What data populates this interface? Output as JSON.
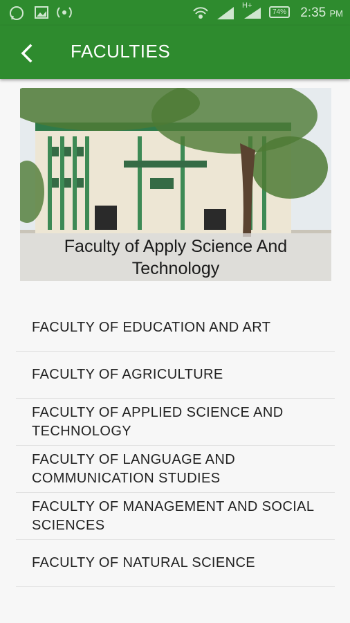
{
  "status_bar": {
    "time": "2:35",
    "ampm": "PM",
    "battery": "74%",
    "network": "H+",
    "icons": [
      "whatsapp-icon",
      "gallery-icon",
      "hotspot-icon",
      "wifi-icon",
      "signal-icon",
      "battery-icon"
    ]
  },
  "app_bar": {
    "title": "FACULTIES",
    "back_icon": "back-arrow-icon"
  },
  "hero": {
    "caption": "Faculty of Apply Science And Technology"
  },
  "faculties": [
    "FACULTY OF EDUCATION AND ART",
    "FACULTY OF AGRICULTURE",
    "FACULTY OF APPLIED SCIENCE AND TECHNOLOGY",
    "FACULTY OF LANGUAGE AND COMMUNICATION STUDIES",
    "FACULTY OF MANAGEMENT AND SOCIAL SCIENCES",
    "FACULTY OF NATURAL SCIENCE"
  ],
  "colors": {
    "primary": "#2e8b2e",
    "background": "#f7f7f7"
  }
}
